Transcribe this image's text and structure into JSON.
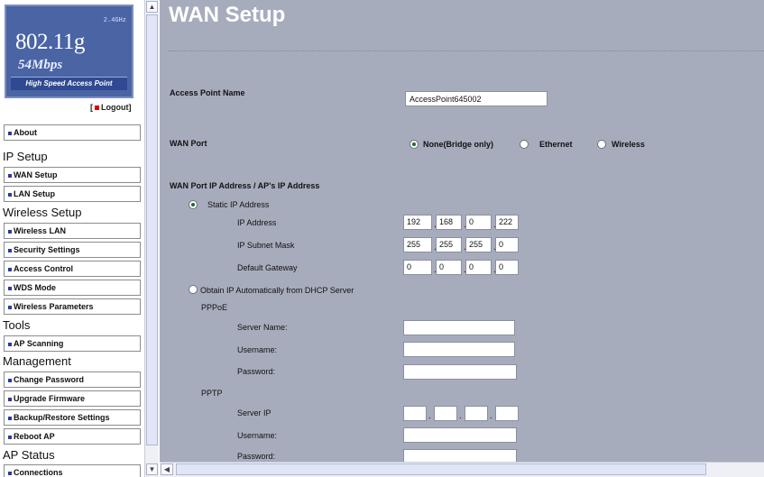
{
  "logo": {
    "frequency": "2.4GHz",
    "standard": "802.11g",
    "rate": "54Mbps",
    "tagline": "High Speed Access Point"
  },
  "logout_label": "Logout",
  "nav": {
    "about": "About",
    "ip_setup": "IP Setup",
    "wan_setup": "WAN Setup",
    "lan_setup": "LAN Setup",
    "wireless_setup": "Wireless Setup",
    "wireless_lan": "Wireless LAN",
    "security_settings": "Security Settings",
    "access_control": "Access Control",
    "wds_mode": "WDS Mode",
    "wireless_parameters": "Wireless Parameters",
    "tools": "Tools",
    "ap_scanning": "AP Scanning",
    "management": "Management",
    "change_password": "Change Password",
    "upgrade_firmware": "Upgrade Firmware",
    "backup_restore": "Backup/Restore Settings",
    "reboot_ap": "Reboot AP",
    "ap_status": "AP Status",
    "connections": "Connections"
  },
  "page": {
    "title": "WAN Setup",
    "ap_name_label": "Access Point Name",
    "ap_name_value": "AccessPoint645002",
    "wan_port_label": "WAN Port",
    "wan_port_options": {
      "none": "None(Bridge only)",
      "ethernet": "Ethernet",
      "wireless": "Wireless"
    },
    "wan_port_selected": "none",
    "ip_section_label": "WAN Port IP Address / AP's IP Address",
    "static_label": "Static IP Address",
    "ip_address_label": "IP Address",
    "ip_address": [
      "192",
      "168",
      "0",
      "222"
    ],
    "subnet_label": "IP Subnet Mask",
    "subnet": [
      "255",
      "255",
      "255",
      "0"
    ],
    "gateway_label": "Default Gateway",
    "gateway": [
      "0",
      "0",
      "0",
      "0"
    ],
    "dhcp_label": "Obtain IP Automatically from DHCP Server",
    "pppoe_label": "PPPoE",
    "pppoe_server_label": "Server Name:",
    "pppoe_username_label": "Username:",
    "pppoe_password_label": "Password:",
    "pptp_label": "PPTP",
    "pptp_server_ip_label": "Server IP",
    "pptp_username_label": "Username:",
    "pptp_password_label": "Password:"
  },
  "colors": {
    "content_bg": "#a7acbd",
    "logo_bg": "#4a64a4",
    "title": "#ffffff"
  }
}
